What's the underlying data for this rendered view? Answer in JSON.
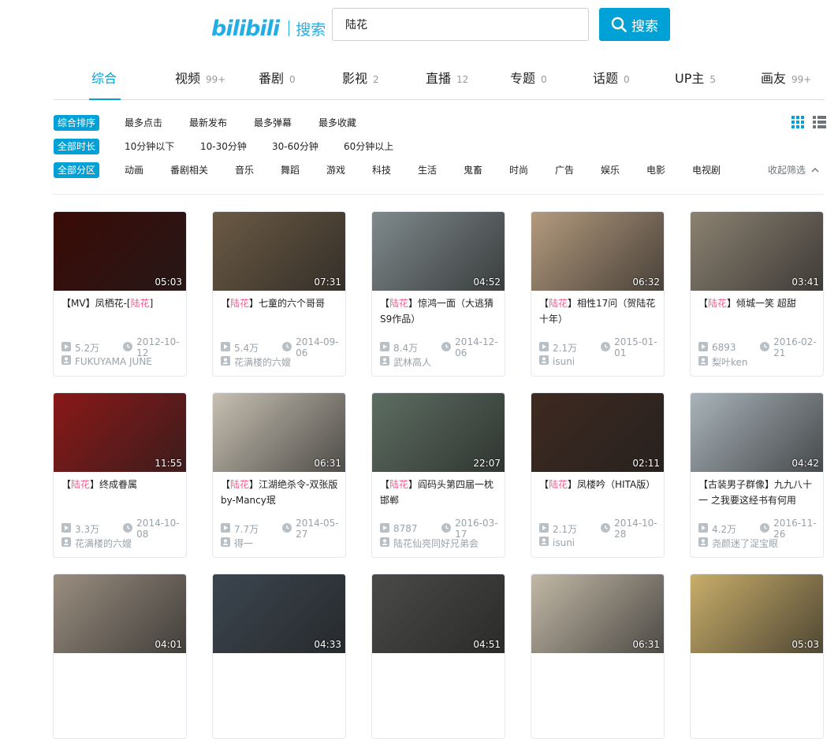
{
  "header": {
    "logo": "bilibili",
    "logo_suffix": "搜索",
    "search_value": "陆花",
    "search_button": "搜索"
  },
  "tabs": [
    {
      "label": "综合",
      "count": ""
    },
    {
      "label": "视频",
      "count": "99+"
    },
    {
      "label": "番剧",
      "count": "0"
    },
    {
      "label": "影视",
      "count": "2"
    },
    {
      "label": "直播",
      "count": "12"
    },
    {
      "label": "专题",
      "count": "0"
    },
    {
      "label": "话题",
      "count": "0"
    },
    {
      "label": "UP主",
      "count": "5"
    },
    {
      "label": "画友",
      "count": "99+"
    }
  ],
  "filters": {
    "sort": {
      "active": "综合排序",
      "options": [
        "最多点击",
        "最新发布",
        "最多弹幕",
        "最多收藏"
      ]
    },
    "duration": {
      "active": "全部时长",
      "options": [
        "10分钟以下",
        "10-30分钟",
        "30-60分钟",
        "60分钟以上"
      ]
    },
    "zone": {
      "active": "全部分区",
      "options": [
        "动画",
        "番剧相关",
        "音乐",
        "舞蹈",
        "游戏",
        "科技",
        "生活",
        "鬼畜",
        "时尚",
        "广告",
        "娱乐",
        "电影",
        "电视剧"
      ]
    },
    "collapse": "收起筛选"
  },
  "videos": [
    {
      "prefix": "【MV】凤栖花-[",
      "hl": "陆花",
      "suffix": "]",
      "duration": "05:03",
      "plays": "5.2万",
      "date": "2012-10-12",
      "up": "FUKUYAMA JUNE",
      "color": "#3a0a06"
    },
    {
      "prefix": "【",
      "hl": "陆花",
      "suffix": "】七童的六个哥哥",
      "duration": "07:31",
      "plays": "5.4万",
      "date": "2014-09-06",
      "up": "花满楼的六嫂",
      "color": "#6b5a44"
    },
    {
      "prefix": "【",
      "hl": "陆花",
      "suffix": "】惊鸿一面（大逃猜S9作品）",
      "duration": "04:52",
      "plays": "8.4万",
      "date": "2014-12-06",
      "up": "武林高人",
      "color": "#7f8a8c"
    },
    {
      "prefix": "【",
      "hl": "陆花",
      "suffix": "】相性17问（贺陆花十年）",
      "duration": "06:32",
      "plays": "2.1万",
      "date": "2015-01-01",
      "up": "isuni",
      "color": "#b49a7e"
    },
    {
      "prefix": "【",
      "hl": "陆花",
      "suffix": "】倾城一笑 超甜",
      "duration": "03:41",
      "plays": "6893",
      "date": "2016-02-21",
      "up": "梨叶ken",
      "color": "#8c8272"
    },
    {
      "prefix": "【",
      "hl": "陆花",
      "suffix": "】终成眷属",
      "duration": "11:55",
      "plays": "3.3万",
      "date": "2014-10-08",
      "up": "花满楼的六嫂",
      "color": "#8a1818"
    },
    {
      "prefix": "【",
      "hl": "陆花",
      "suffix": "】江湖绝杀令-双张版 by-Mancy珉",
      "duration": "06:31",
      "plays": "7.7万",
      "date": "2014-05-27",
      "up": "得一",
      "color": "#c7c0b2"
    },
    {
      "prefix": "【",
      "hl": "陆花",
      "suffix": "】阎码头第四届一枕邯郸",
      "duration": "22:07",
      "plays": "8787",
      "date": "2016-03-17",
      "up": "陆花仙亮同好兄弟会",
      "color": "#5d6e62"
    },
    {
      "prefix": "【",
      "hl": "陆花",
      "suffix": "】凤楼吟（HITA版）",
      "duration": "02:11",
      "plays": "2.1万",
      "date": "2014-10-28",
      "up": "isuni",
      "color": "#3e2a20"
    },
    {
      "prefix": "【古装男子群像】九九八十一 之我要这经书有何用",
      "hl": "",
      "suffix": "",
      "duration": "04:42",
      "plays": "4.2万",
      "date": "2016-11-26",
      "up": "尧颜迷了浞宝眼",
      "color": "#a9b4ba"
    },
    {
      "prefix": "",
      "hl": "",
      "suffix": "",
      "duration": "04:01",
      "plays": "",
      "date": "",
      "up": "",
      "color": "#9a8e80"
    },
    {
      "prefix": "",
      "hl": "",
      "suffix": "",
      "duration": "04:33",
      "plays": "",
      "date": "",
      "up": "",
      "color": "#3c4650"
    },
    {
      "prefix": "",
      "hl": "",
      "suffix": "",
      "duration": "04:51",
      "plays": "",
      "date": "",
      "up": "",
      "color": "#4a4a48"
    },
    {
      "prefix": "",
      "hl": "",
      "suffix": "",
      "duration": "06:31",
      "plays": "",
      "date": "",
      "up": "",
      "color": "#c2b8a6"
    },
    {
      "prefix": "",
      "hl": "",
      "suffix": "",
      "duration": "05:03",
      "plays": "",
      "date": "",
      "up": "",
      "color": "#c9ae6a"
    }
  ],
  "icons": {
    "search": "search-icon",
    "play": "play-icon",
    "date": "clock-icon",
    "up": "user-icon",
    "grid": "grid-view-icon",
    "list": "list-view-icon",
    "collapse": "chevron-up-icon"
  },
  "colors": {
    "accent": "#00a1d6",
    "highlight": "#f25d8e",
    "muted": "#99a2aa"
  }
}
